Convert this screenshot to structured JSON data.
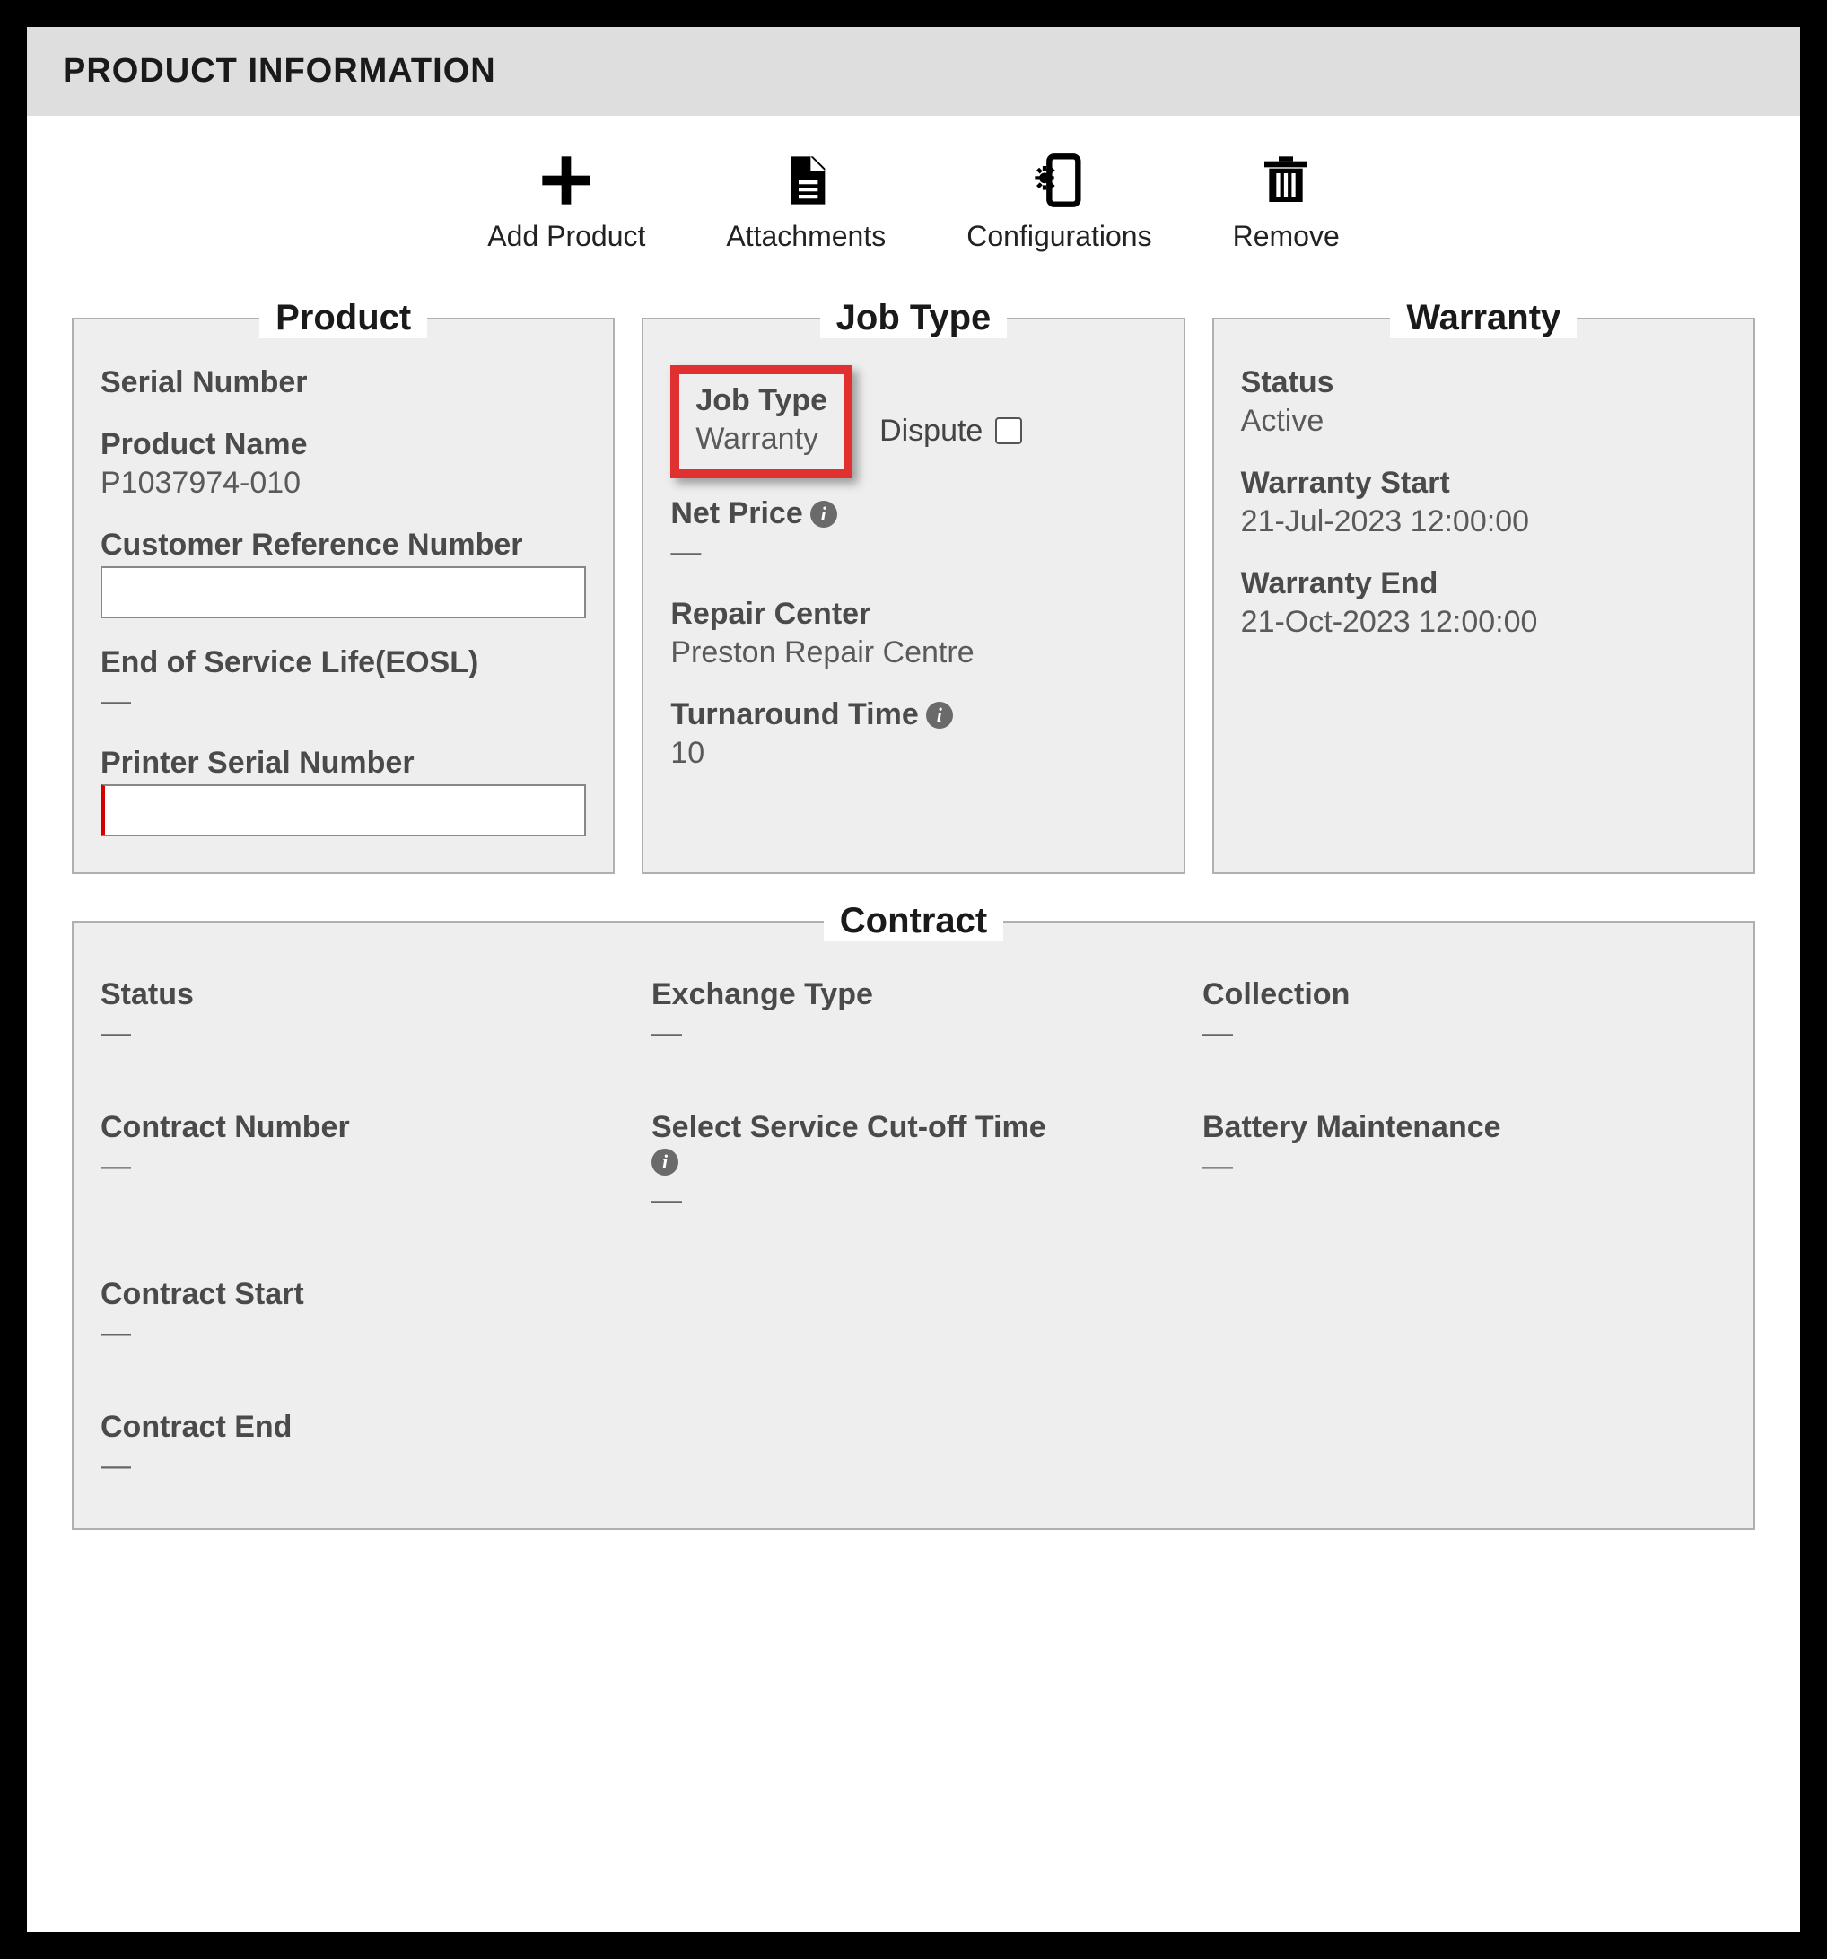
{
  "header": {
    "title": "PRODUCT INFORMATION"
  },
  "toolbar": {
    "add_product": "Add Product",
    "attachments": "Attachments",
    "configurations": "Configurations",
    "remove": "Remove"
  },
  "product": {
    "legend": "Product",
    "serial_number_label": "Serial Number",
    "serial_number_value": "",
    "product_name_label": "Product Name",
    "product_name_value": "P1037974-010",
    "customer_ref_label": "Customer Reference Number",
    "customer_ref_value": "",
    "eosl_label": "End of Service Life(EOSL)",
    "eosl_value": "—",
    "printer_sn_label": "Printer Serial Number",
    "printer_sn_value": ""
  },
  "jobtype": {
    "legend": "Job Type",
    "job_type_label": "Job Type",
    "job_type_value": "Warranty",
    "dispute_label": "Dispute",
    "net_price_label": "Net Price",
    "net_price_value": "—",
    "repair_center_label": "Repair Center",
    "repair_center_value": "Preston Repair Centre",
    "turnaround_label": "Turnaround Time",
    "turnaround_value": "10"
  },
  "warranty": {
    "legend": "Warranty",
    "status_label": "Status",
    "status_value": "Active",
    "start_label": "Warranty Start",
    "start_value": "21-Jul-2023 12:00:00",
    "end_label": "Warranty End",
    "end_value": "21-Oct-2023 12:00:00"
  },
  "contract": {
    "legend": "Contract",
    "status_label": "Status",
    "status_value": "—",
    "exchange_label": "Exchange Type",
    "exchange_value": "—",
    "collection_label": "Collection",
    "collection_value": "—",
    "number_label": "Contract Number",
    "number_value": "—",
    "cutoff_label": "Select Service Cut-off Time",
    "cutoff_value": "—",
    "battery_label": "Battery Maintenance",
    "battery_value": "—",
    "start_label": "Contract Start",
    "start_value": "—",
    "end_label": "Contract End",
    "end_value": "—"
  }
}
